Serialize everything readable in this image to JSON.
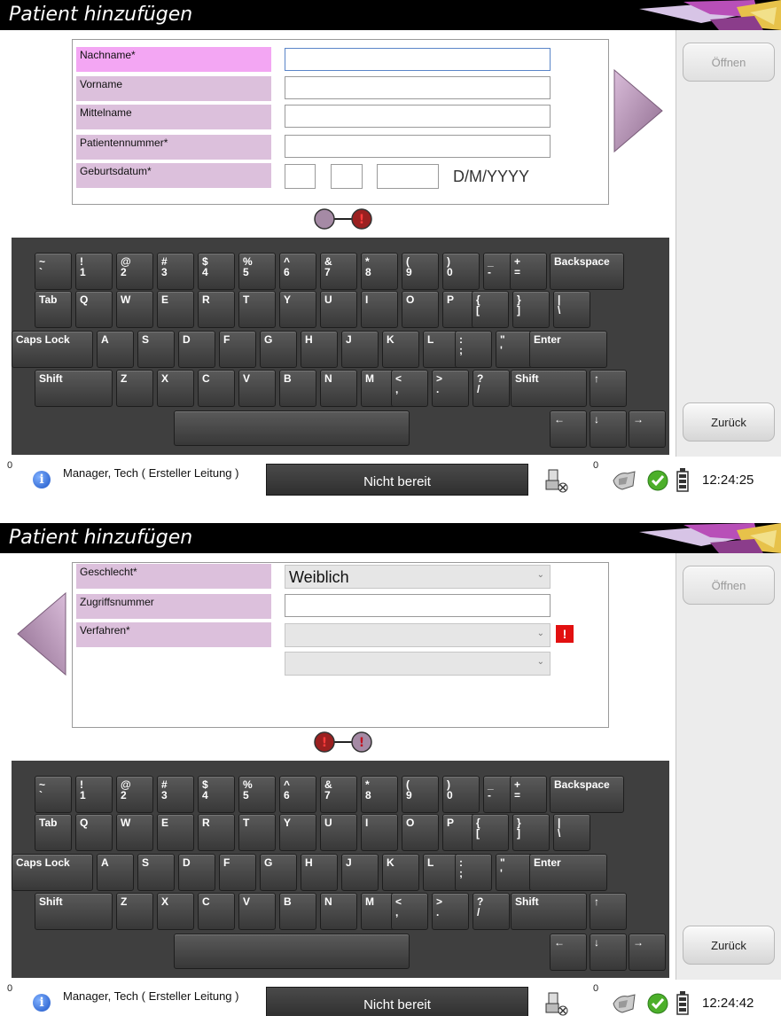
{
  "keyboard": {
    "number_row": [
      {
        "top": "~",
        "bottom": "`"
      },
      {
        "top": "!",
        "bottom": "1"
      },
      {
        "top": "@",
        "bottom": "2"
      },
      {
        "top": "#",
        "bottom": "3"
      },
      {
        "top": "$",
        "bottom": "4"
      },
      {
        "top": "%",
        "bottom": "5"
      },
      {
        "top": "^",
        "bottom": "6"
      },
      {
        "top": "&",
        "bottom": "7"
      },
      {
        "top": "*",
        "bottom": "8"
      },
      {
        "top": "(",
        "bottom": "9"
      },
      {
        "top": ")",
        "bottom": "0"
      },
      {
        "top": "_",
        "bottom": "-"
      },
      {
        "top": "+",
        "bottom": "="
      }
    ],
    "backspace_label": "Backspace",
    "tab_label": "Tab",
    "qwerty_row": [
      "Q",
      "W",
      "E",
      "R",
      "T",
      "Y",
      "U",
      "I",
      "O",
      "P"
    ],
    "qwerty_symbols": [
      {
        "top": "{",
        "bottom": "["
      },
      {
        "top": "}",
        "bottom": "]"
      },
      {
        "top": "|",
        "bottom": "\\"
      }
    ],
    "caps_label": "Caps Lock",
    "home_row": [
      "A",
      "S",
      "D",
      "F",
      "G",
      "H",
      "J",
      "K",
      "L"
    ],
    "home_symbols": [
      {
        "top": ":",
        "bottom": ";"
      },
      {
        "top": "\"",
        "bottom": "'"
      }
    ],
    "enter_label": "Enter",
    "shift_label": "Shift",
    "bottom_row": [
      "Z",
      "X",
      "C",
      "V",
      "B",
      "N",
      "M"
    ],
    "bottom_symbols": [
      {
        "top": "<",
        "bottom": ","
      },
      {
        "top": ">",
        "bottom": "."
      },
      {
        "top": "?",
        "bottom": "/"
      }
    ],
    "arrow_up": "↑",
    "arrow_left": "←",
    "arrow_down": "↓",
    "arrow_right": "→"
  },
  "screens": [
    {
      "title": "Patient hinzufügen",
      "open_button": "Öffnen",
      "back_button": "Zurück",
      "fields": [
        {
          "label": "Nachname*",
          "value": "",
          "active": true
        },
        {
          "label": "Vorname",
          "value": ""
        },
        {
          "label": "Mittelname",
          "value": ""
        },
        {
          "label": "Patientennummer*",
          "value": ""
        },
        {
          "label": "Geburtsdatum*",
          "date_format": "D/M/YYYY"
        }
      ],
      "nav": "next",
      "pager": [
        "current",
        "error"
      ],
      "status": {
        "left_count": "0",
        "user": "Manager, Tech ( Ersteller Leitung )",
        "readiness": "Nicht bereit",
        "right_count": "0",
        "time": "12:24:25"
      }
    },
    {
      "title": "Patient hinzufügen",
      "open_button": "Öffnen",
      "back_button": "Zurück",
      "fields": [
        {
          "label": "Geschlecht*",
          "value": "Weiblich",
          "type": "select"
        },
        {
          "label": "Zugriffsnummer",
          "value": ""
        },
        {
          "label": "Verfahren*",
          "value": "",
          "type": "select",
          "error": "!"
        },
        {
          "label": "",
          "value": "",
          "type": "select"
        }
      ],
      "nav": "prev",
      "pager": [
        "error",
        "current"
      ],
      "status": {
        "left_count": "0",
        "user": "Manager, Tech ( Ersteller Leitung )",
        "readiness": "Nicht bereit",
        "right_count": "0",
        "time": "12:24:42"
      }
    }
  ],
  "colors": {
    "label_bg": "#dcc0dc",
    "label_active_bg": "#f3a6f3",
    "arrow_fill": "#b48fb4",
    "error_red": "#e21010"
  }
}
